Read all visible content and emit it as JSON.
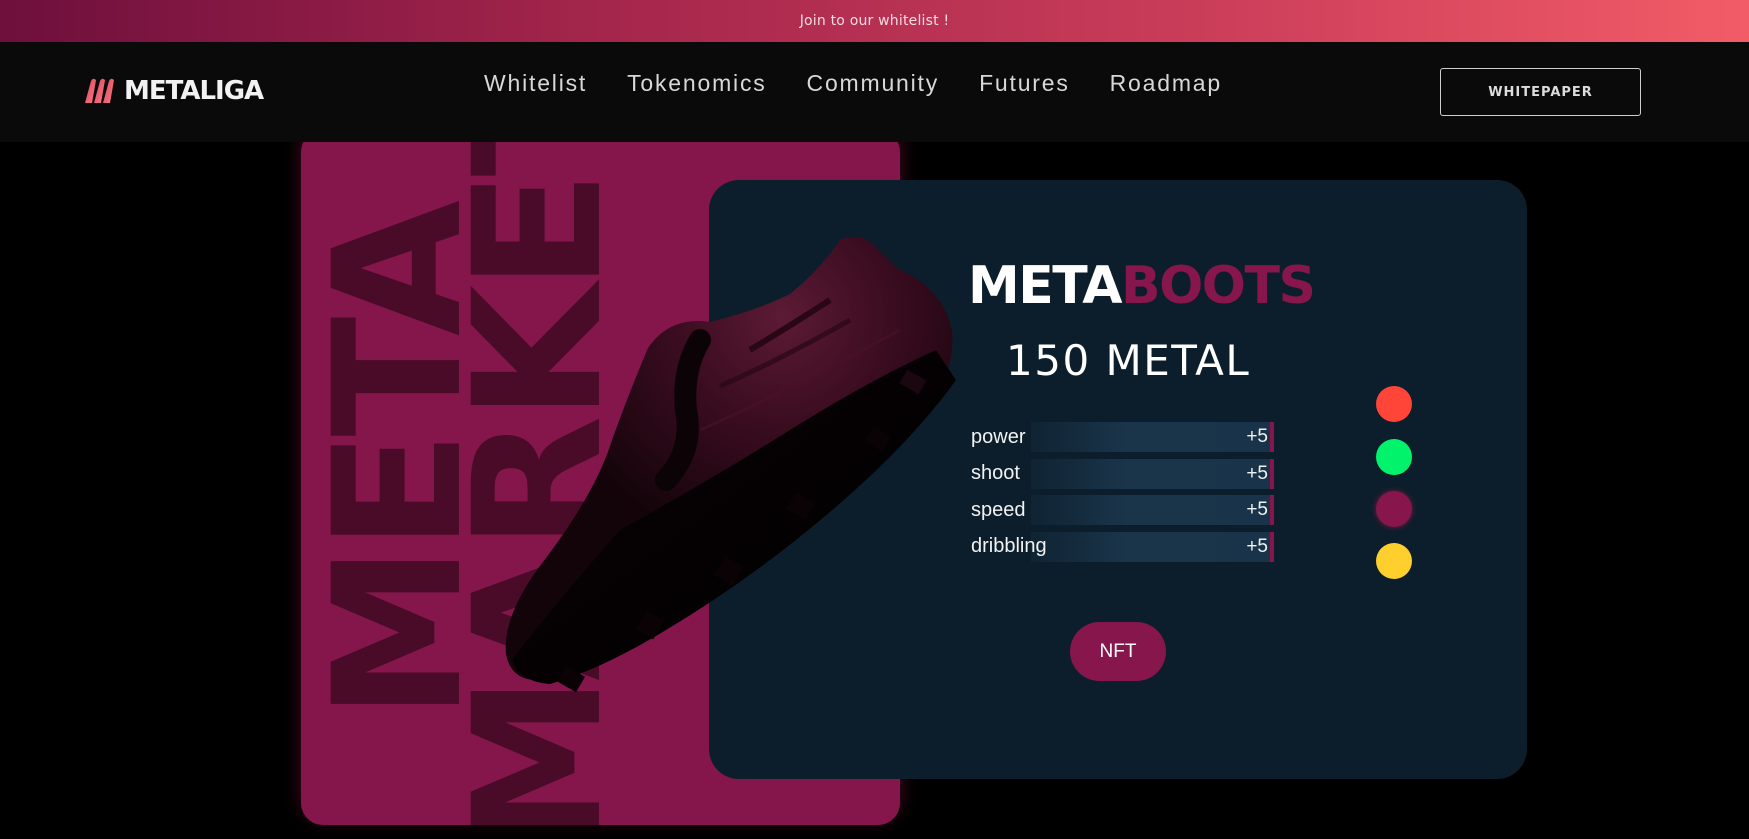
{
  "announcement": {
    "text": "Join to our whitelist !"
  },
  "brand": {
    "name": "METALIGA"
  },
  "nav": {
    "links": [
      {
        "label": "Whitelist"
      },
      {
        "label": "Tokenomics"
      },
      {
        "label": "Community"
      },
      {
        "label": "Futures"
      },
      {
        "label": "Roadmap"
      }
    ],
    "cta_label": "WHITEPAPER"
  },
  "poster": {
    "word1": "META",
    "word2": "MARKET"
  },
  "product": {
    "title_primary": "META",
    "title_accent": "BOOTS",
    "price": "150 METAL",
    "stats": [
      {
        "label": "power",
        "value": "+5"
      },
      {
        "label": "shoot",
        "value": "+5"
      },
      {
        "label": "speed",
        "value": "+5"
      },
      {
        "label": "dribbling",
        "value": "+5"
      }
    ],
    "button_label": "NFT",
    "color_options": [
      "#ff4438",
      "#00f36b",
      "#86164c",
      "#ffcf2d"
    ],
    "selected_color": "#86164c"
  },
  "colors": {
    "accent": "#86164c",
    "card_bg": "#0c1e2b",
    "poster_bg": "#84164c"
  }
}
